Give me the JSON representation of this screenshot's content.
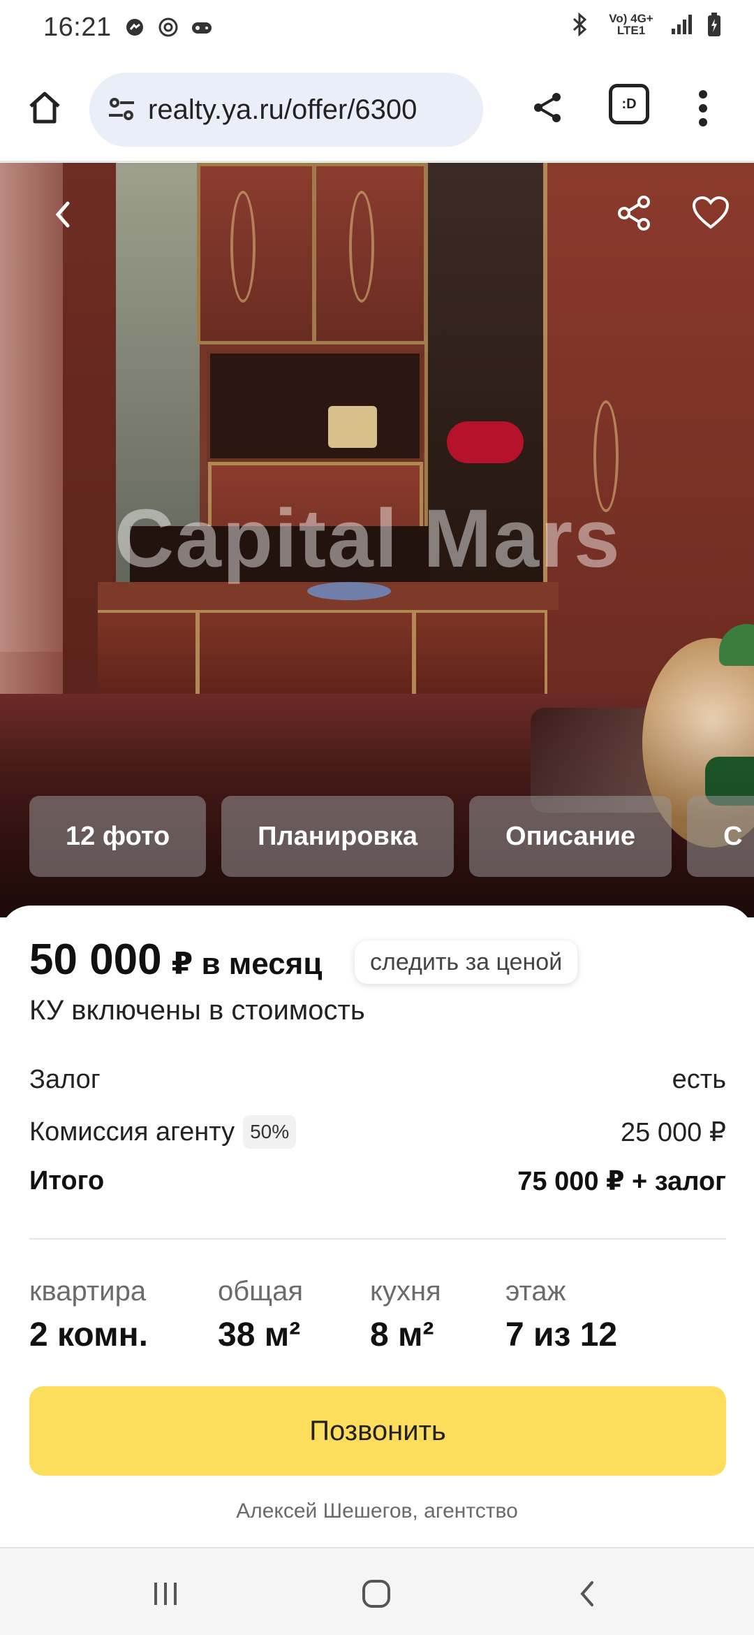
{
  "status_bar": {
    "time": "16:21",
    "network": "Vo) 4G+ LTE1",
    "icons": [
      "messenger-icon",
      "at-icon",
      "game-icon",
      "bluetooth-icon",
      "signal-icon",
      "battery-icon"
    ]
  },
  "browser": {
    "url": "realty.ya.ru/offer/6300",
    "tab_label": ":D"
  },
  "photo": {
    "watermark": "Capital Mars",
    "chips": [
      {
        "label": "12 фото"
      },
      {
        "label": "Планировка"
      },
      {
        "label": "Описание"
      },
      {
        "label": "С"
      }
    ]
  },
  "offer": {
    "price": "50 000",
    "price_suffix": "₽ в месяц",
    "track_price": "следить за ценой",
    "utilities": "КУ включены в стоимость",
    "costs": [
      {
        "label": "Залог",
        "value": "есть"
      },
      {
        "label": "Комиссия агенту",
        "badge": "50%",
        "value": "25 000 ₽"
      },
      {
        "label": "Итого",
        "value": "75 000 ₽ + залог"
      }
    ],
    "specs": [
      {
        "label": "квартира",
        "value": "2 комн."
      },
      {
        "label": "общая",
        "value": "38 м²"
      },
      {
        "label": "кухня",
        "value": "8 м²"
      },
      {
        "label": "этаж",
        "value": "7 из 12"
      }
    ],
    "call_button": "Позвонить",
    "agent": "Алексей Шешегов, агентство"
  },
  "colors": {
    "accent_yellow": "#fddd5c",
    "url_bg": "#e9eef8"
  }
}
